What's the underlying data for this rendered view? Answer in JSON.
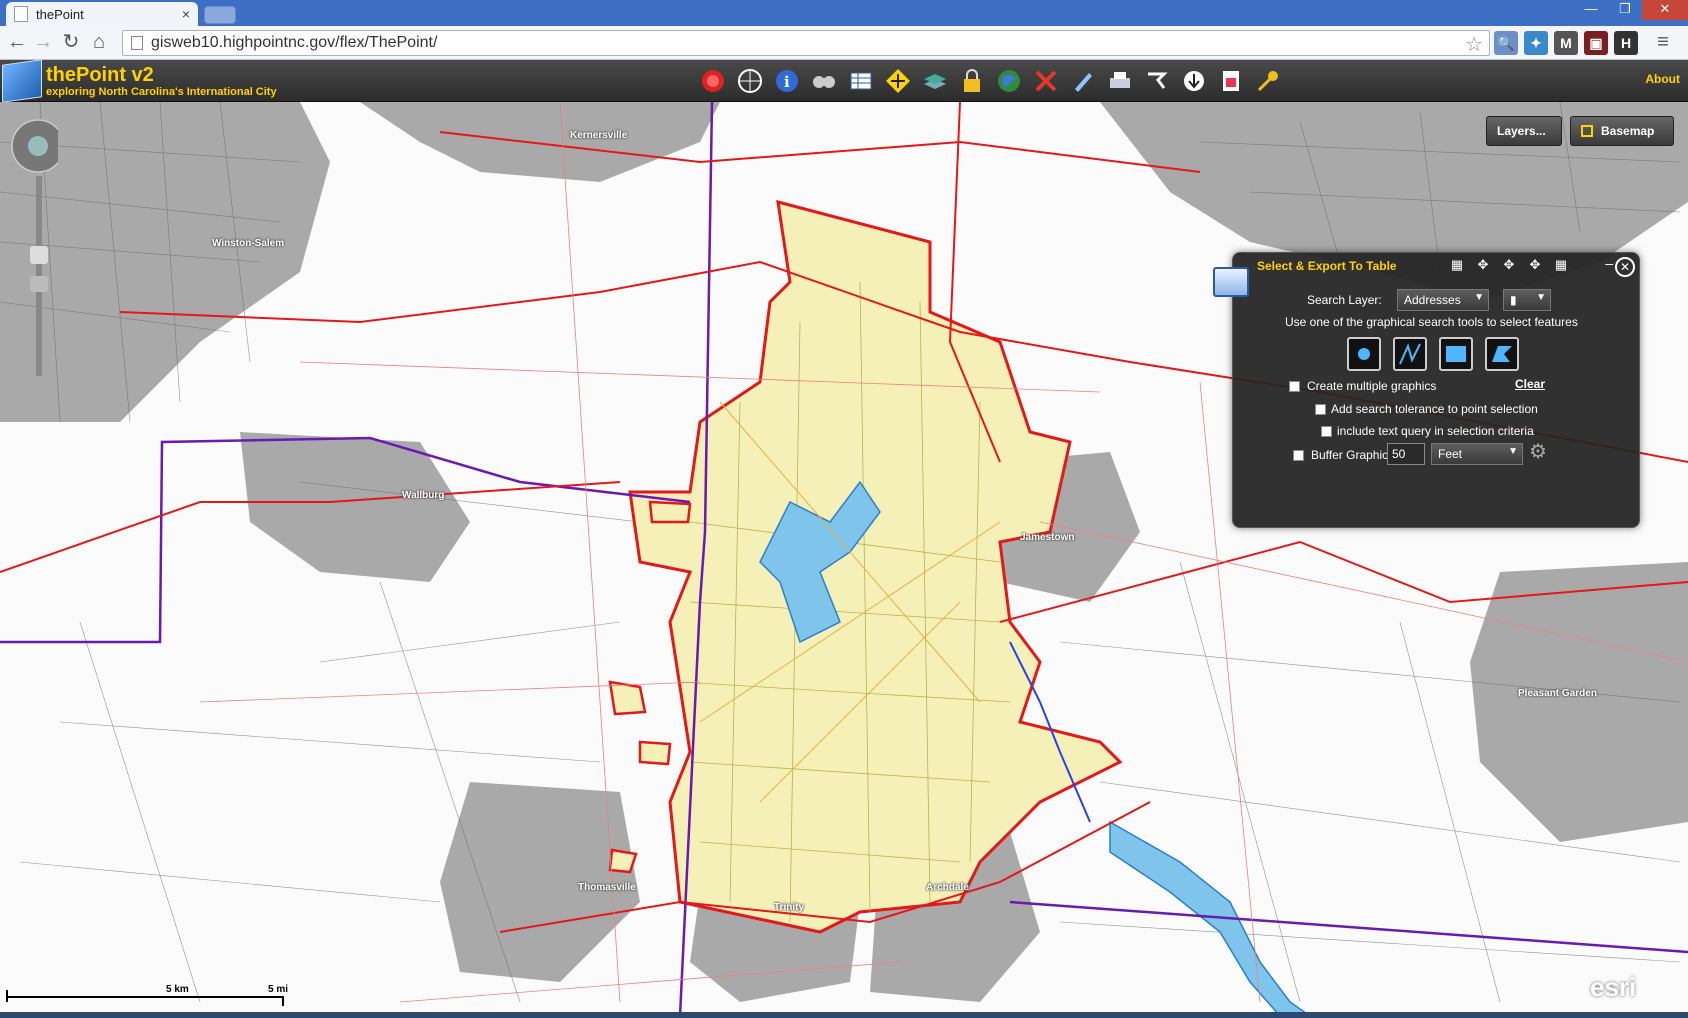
{
  "browser": {
    "tab_title": "thePoint",
    "tab_close": "×",
    "url": "gisweb10.highpointnc.gov/flex/ThePoint/",
    "window_controls": [
      "—",
      "❐",
      "✕"
    ],
    "ext_badges": [
      "M",
      "H"
    ]
  },
  "app": {
    "title": "thePoint v2",
    "subtitle": "exploring North Carolina's International City",
    "about": "About",
    "toolbar_icons": [
      "record-icon",
      "compass-icon",
      "info-icon",
      "binoculars-icon",
      "table-icon",
      "pan-icon",
      "layers-icon",
      "lock-icon",
      "globe-icon",
      "erase-icon",
      "pencil-icon",
      "print-icon",
      "pointer-icon",
      "download-icon",
      "report-icon",
      "key-icon"
    ]
  },
  "map": {
    "layers_button": "Layers...",
    "basemap_button": "Basemap",
    "labels": [
      "Kernersville",
      "Winston-Salem",
      "Wallburg",
      "Jamestown",
      "Pleasant Garden",
      "Thomasville",
      "Archdale",
      "Trinity"
    ],
    "scale_top": "5 km",
    "scale_bottom": "5 mi",
    "esri": "esri"
  },
  "panel": {
    "title": "Select & Export To Table",
    "search_layer_label": "Search Layer:",
    "search_layer_value": "Addresses",
    "instructions": "Use one of the graphical search tools to select features",
    "create_multiple": "Create multiple graphics",
    "clear": "Clear",
    "add_tolerance": "Add search tolerance to point selection",
    "text_query": "include text query in selection criteria",
    "buffer_label": "Buffer Graphic",
    "buffer_value": "50",
    "buffer_unit": "Feet"
  }
}
